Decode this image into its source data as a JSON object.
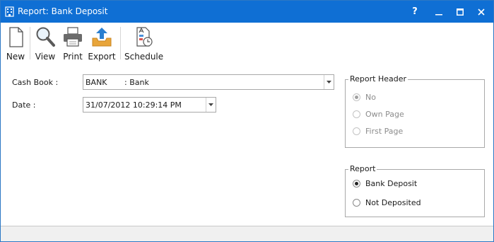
{
  "window": {
    "title": "Report: Bank Deposit",
    "controls": {
      "help": "?",
      "minimize": "–",
      "maximize": "☐",
      "close": "✕"
    }
  },
  "toolbar": {
    "new_label": "New",
    "view_label": "View",
    "print_label": "Print",
    "export_label": "Export",
    "schedule_label": "Schedule"
  },
  "form": {
    "cash_book_label": "Cash Book :",
    "cash_book_value": "BANK       : Bank",
    "date_label": "Date :",
    "date_value": "31/07/2012 10:29:14 PM"
  },
  "report_header": {
    "legend": "Report Header",
    "options": [
      {
        "label": "No",
        "selected": true,
        "enabled": false
      },
      {
        "label": "Own Page",
        "selected": false,
        "enabled": false
      },
      {
        "label": "First Page",
        "selected": false,
        "enabled": false
      }
    ]
  },
  "report": {
    "legend": "Report",
    "options": [
      {
        "label": "Bank Deposit",
        "selected": true,
        "enabled": true
      },
      {
        "label": "Not Deposited",
        "selected": false,
        "enabled": true
      }
    ]
  },
  "colors": {
    "titlebar": "#0f6fd4",
    "accent_icon": "#2a7fd0",
    "export_tray": "#e8a53a"
  }
}
